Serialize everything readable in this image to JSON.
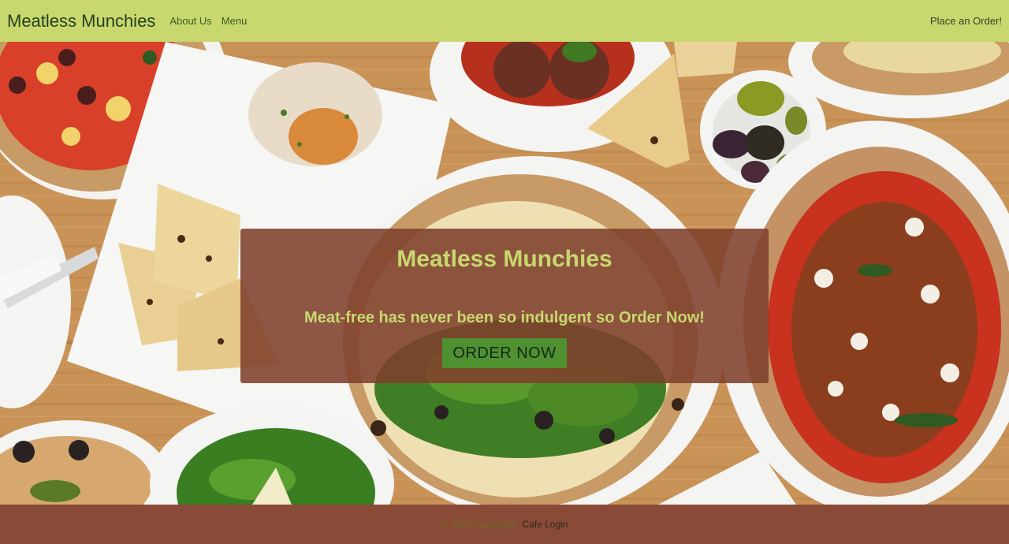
{
  "navbar": {
    "brand": "Meatless Munchies",
    "links": [
      {
        "label": "About Us"
      },
      {
        "label": "Menu"
      }
    ],
    "order_link": "Place an Order!"
  },
  "hero": {
    "title": "Meatless Munchies",
    "tagline": "Meat-free has never been so indulgent so Order Now!",
    "button_label": "ORDER NOW"
  },
  "footer": {
    "copyright": "© 2023 Copyright:",
    "login_link": "Cafe Login"
  },
  "colors": {
    "navbar_bg": "#c8d86e",
    "overlay_bg": "#80402c",
    "button_bg": "#4f9131",
    "footer_bg": "#8a4a38"
  }
}
